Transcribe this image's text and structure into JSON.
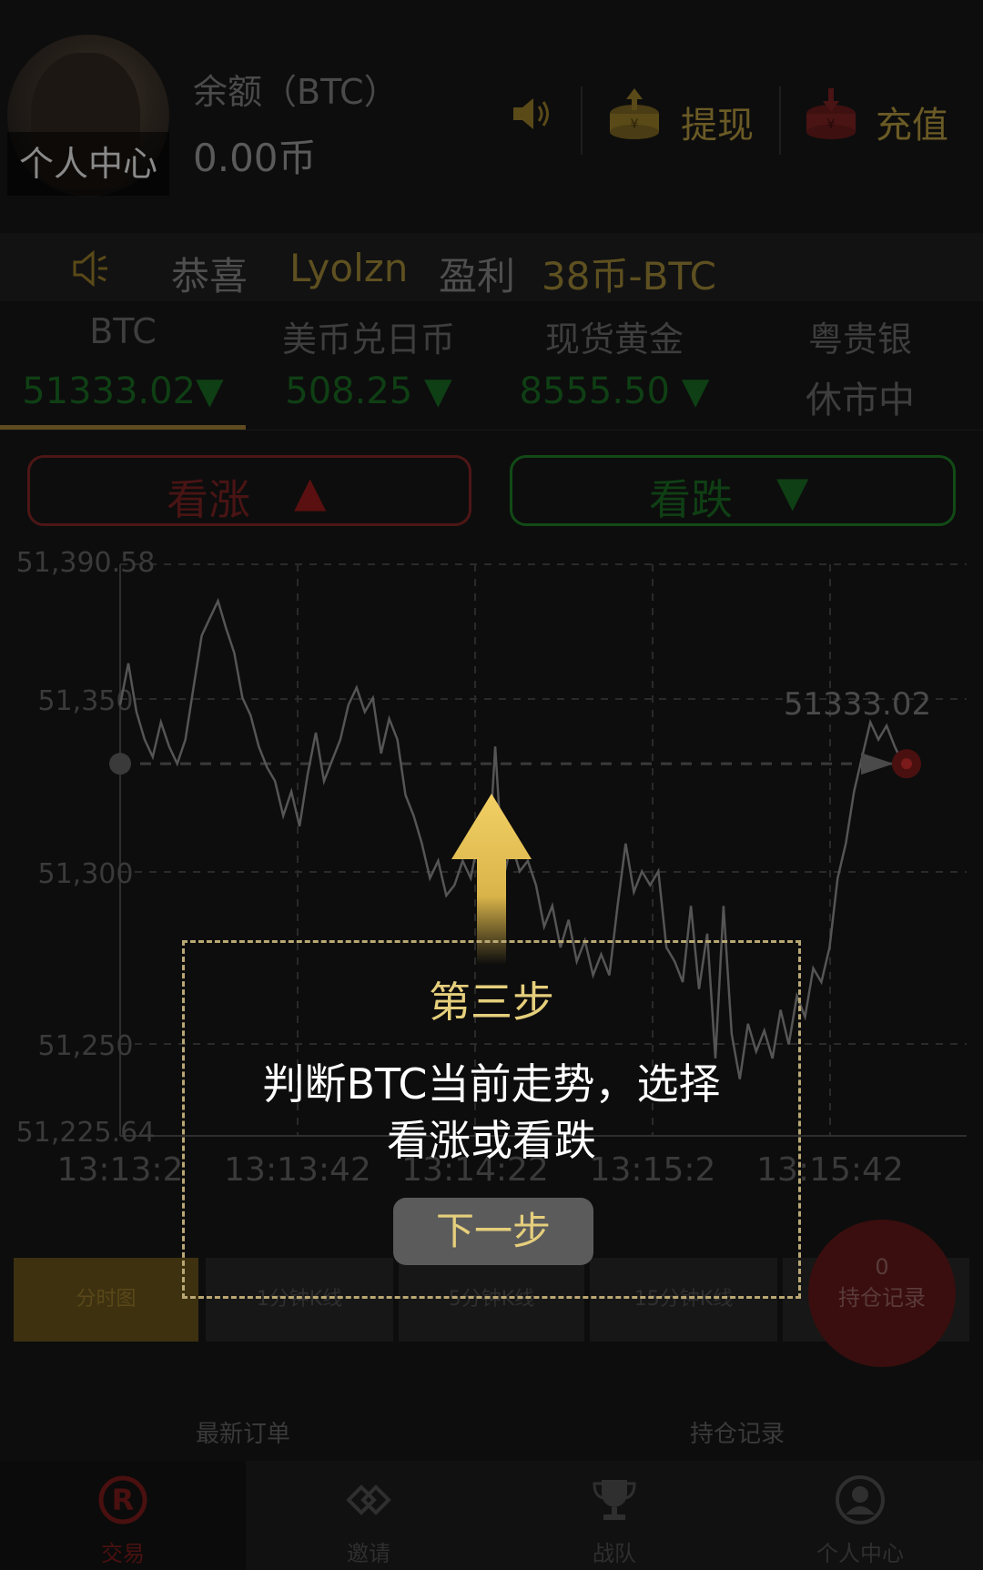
{
  "header": {
    "avatar_label": "个人中心",
    "balance_label": "余额（BTC）",
    "balance_value": "0.00币",
    "withdraw_label": "提现",
    "deposit_label": "充值"
  },
  "ticker": {
    "congrats": "恭喜",
    "user": "Lyolzn",
    "profit_label": "盈利",
    "profit_value": "38币-BTC"
  },
  "markets": [
    {
      "name": "BTC",
      "value": "51333.02",
      "trend": "▼"
    },
    {
      "name": "美币兑日币",
      "value": "508.25",
      "trend": "▼"
    },
    {
      "name": "现货黄金",
      "value": "8555.50",
      "trend": "▼"
    },
    {
      "name": "粤贵银",
      "value": "休市中",
      "trend": ""
    }
  ],
  "trade": {
    "up_label": "看涨",
    "down_label": "看跌",
    "up_icon": "▲",
    "down_icon": "▼"
  },
  "chart_data": {
    "type": "line",
    "y_ticks": [
      "51,390.58",
      "51,350",
      "51,300",
      "51,250",
      "51,225.64"
    ],
    "x_ticks": [
      "13:13:2",
      "13:13:42",
      "13:14:22",
      "13:15:2",
      "13:15:42"
    ],
    "ylim": [
      51225.64,
      51390.58
    ],
    "current_price": "51333.02",
    "reference_price": 51333.02,
    "grid": true,
    "values": [
      51350,
      51362,
      51348,
      51340,
      51335,
      51345,
      51338,
      51333,
      51340,
      51355,
      51370,
      51375,
      51380,
      51372,
      51365,
      51352,
      51347,
      51338,
      51332,
      51328,
      51318,
      51325,
      51315,
      51330,
      51342,
      51328,
      51334,
      51340,
      51350,
      51355,
      51348,
      51352,
      51336,
      51346,
      51340,
      51324,
      51318,
      51310,
      51300,
      51305,
      51295,
      51298,
      51305,
      51300,
      51312,
      51298,
      51338,
      51300,
      51310,
      51302,
      51305,
      51298,
      51286,
      51292,
      51280,
      51288,
      51276,
      51282,
      51272,
      51278,
      51272,
      51292,
      51310,
      51296,
      51302,
      51298,
      51302,
      51280,
      51276,
      51270,
      51292,
      51268,
      51284,
      51248,
      51292,
      51255,
      51242,
      51258,
      51250,
      51256,
      51248,
      51262,
      51252,
      51266,
      51260,
      51274,
      51270,
      51280,
      51300,
      51310,
      51325,
      51335,
      51345,
      51340,
      51344,
      51338,
      51333.02
    ]
  },
  "period_tabs": [
    "分时图",
    "1分钟K线",
    "5分钟K线",
    "15分钟K线",
    ""
  ],
  "holdings": {
    "count": "0",
    "label": "持仓记录"
  },
  "orders": {
    "latest": "最新订单",
    "holdings": "持仓记录"
  },
  "nav": [
    {
      "label": "交易",
      "icon": "trade-icon"
    },
    {
      "label": "邀请",
      "icon": "invite-icon"
    },
    {
      "label": "战队",
      "icon": "trophy-icon"
    },
    {
      "label": "个人中心",
      "icon": "profile-icon"
    }
  ],
  "tutorial": {
    "step": "第三步",
    "message_line1": "判断BTC当前走势，选择",
    "message_line2": "看涨或看跌",
    "next": "下一步"
  }
}
